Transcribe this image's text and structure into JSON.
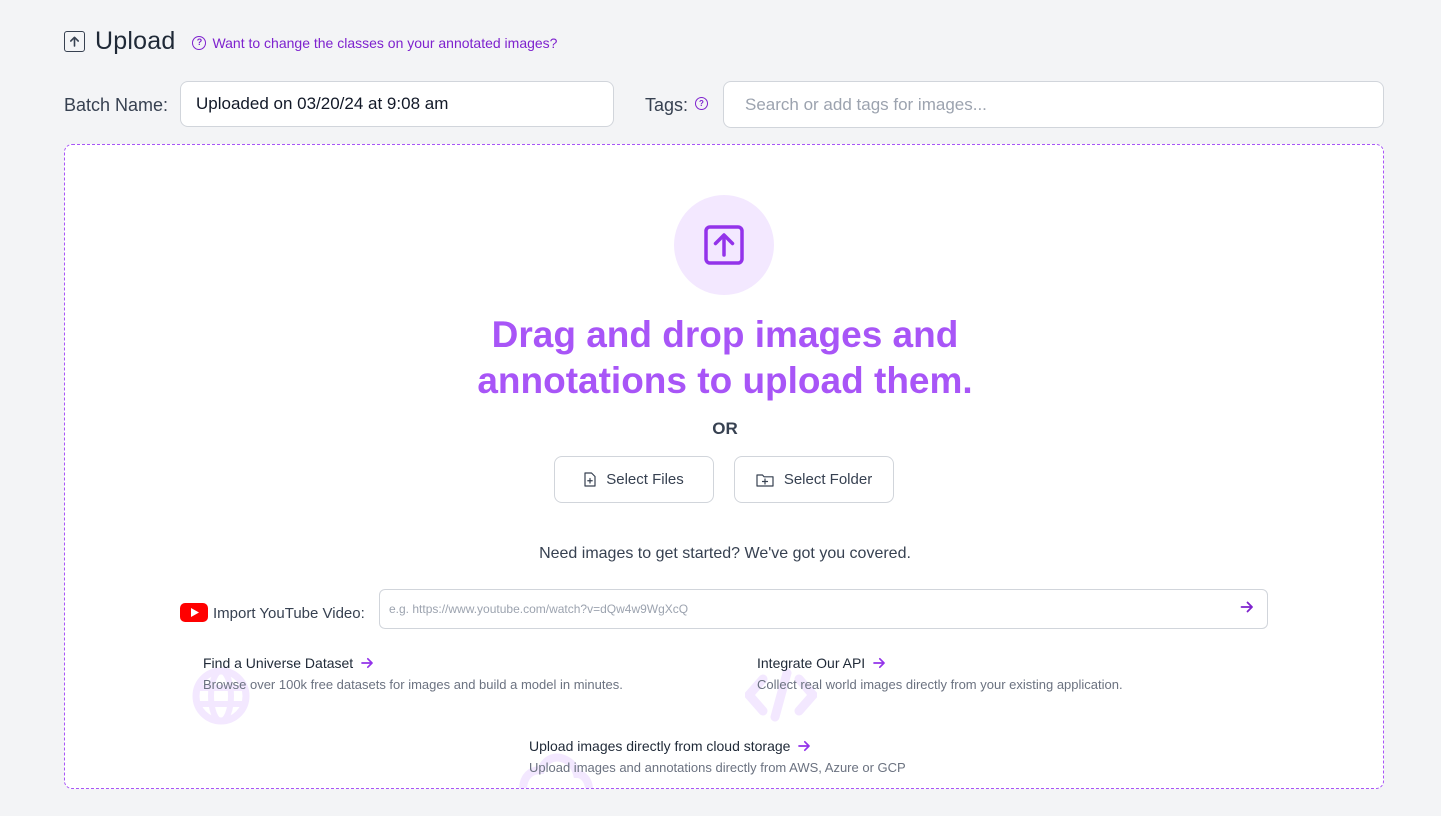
{
  "header": {
    "title": "Upload",
    "help_link": "Want to change the classes on your annotated images?"
  },
  "batch": {
    "label": "Batch Name:",
    "value": "Uploaded on 03/20/24 at 9:08 am"
  },
  "tags": {
    "label": "Tags:",
    "placeholder": "Search or add tags for images..."
  },
  "dropzone": {
    "heading_line1": "Drag and drop images and",
    "heading_line2": "annotations to upload them.",
    "or_text": "OR",
    "select_files_label": "Select Files",
    "select_folder_label": "Select Folder",
    "need_images_text": "Need images to get started? We've got you covered."
  },
  "youtube": {
    "label": "Import YouTube Video:",
    "placeholder": "e.g. https://www.youtube.com/watch?v=dQw4w9WgXcQ"
  },
  "resources": {
    "universe": {
      "title": "Find a Universe Dataset",
      "desc": "Browse over 100k free datasets for images and build a model in minutes.",
      "icon": "globe-icon"
    },
    "api": {
      "title": "Integrate Our API",
      "desc": "Collect real world images directly from your existing application.",
      "icon": "code-icon"
    },
    "cloud": {
      "title": "Upload images directly from cloud storage",
      "desc": "Upload images and annotations directly from AWS, Azure or GCP",
      "icon": "cloud-icon"
    }
  },
  "colors": {
    "accent": "#a855f7",
    "accent_dark": "#7e22ce",
    "accent_light": "#f3e8ff",
    "background": "#f3f4f6",
    "youtube_red": "#ff0000"
  }
}
